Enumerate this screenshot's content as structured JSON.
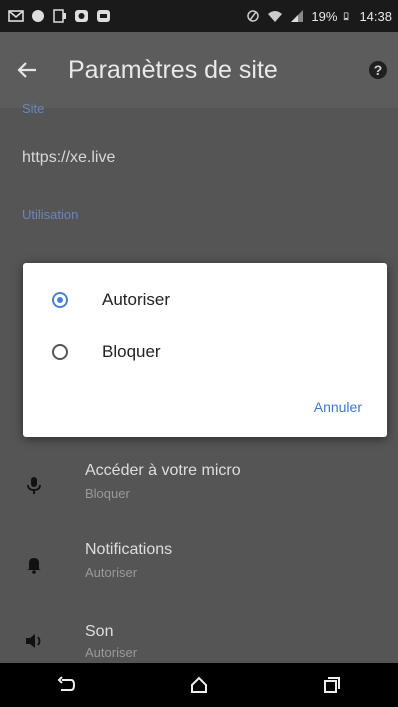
{
  "status_bar": {
    "battery_text": "19%",
    "time": "14:38"
  },
  "toolbar": {
    "title": "Paramètres de site"
  },
  "site_section": {
    "heading": "Site",
    "url": "https://xe.live"
  },
  "usage_section": {
    "heading": "Utilisation"
  },
  "permissions": [
    {
      "title": "Accéder à votre micro",
      "status": "Bloquer",
      "icon": "microphone-icon"
    },
    {
      "title": "Notifications",
      "status": "Autoriser",
      "icon": "bell-icon"
    },
    {
      "title": "Son",
      "status": "Autoriser",
      "icon": "speaker-icon"
    }
  ],
  "dialog": {
    "options": [
      {
        "label": "Autoriser",
        "selected": true
      },
      {
        "label": "Bloquer",
        "selected": false
      }
    ],
    "cancel_label": "Annuler"
  },
  "colors": {
    "accent": "#4a7fd4",
    "cancel": "#3b78d0"
  }
}
